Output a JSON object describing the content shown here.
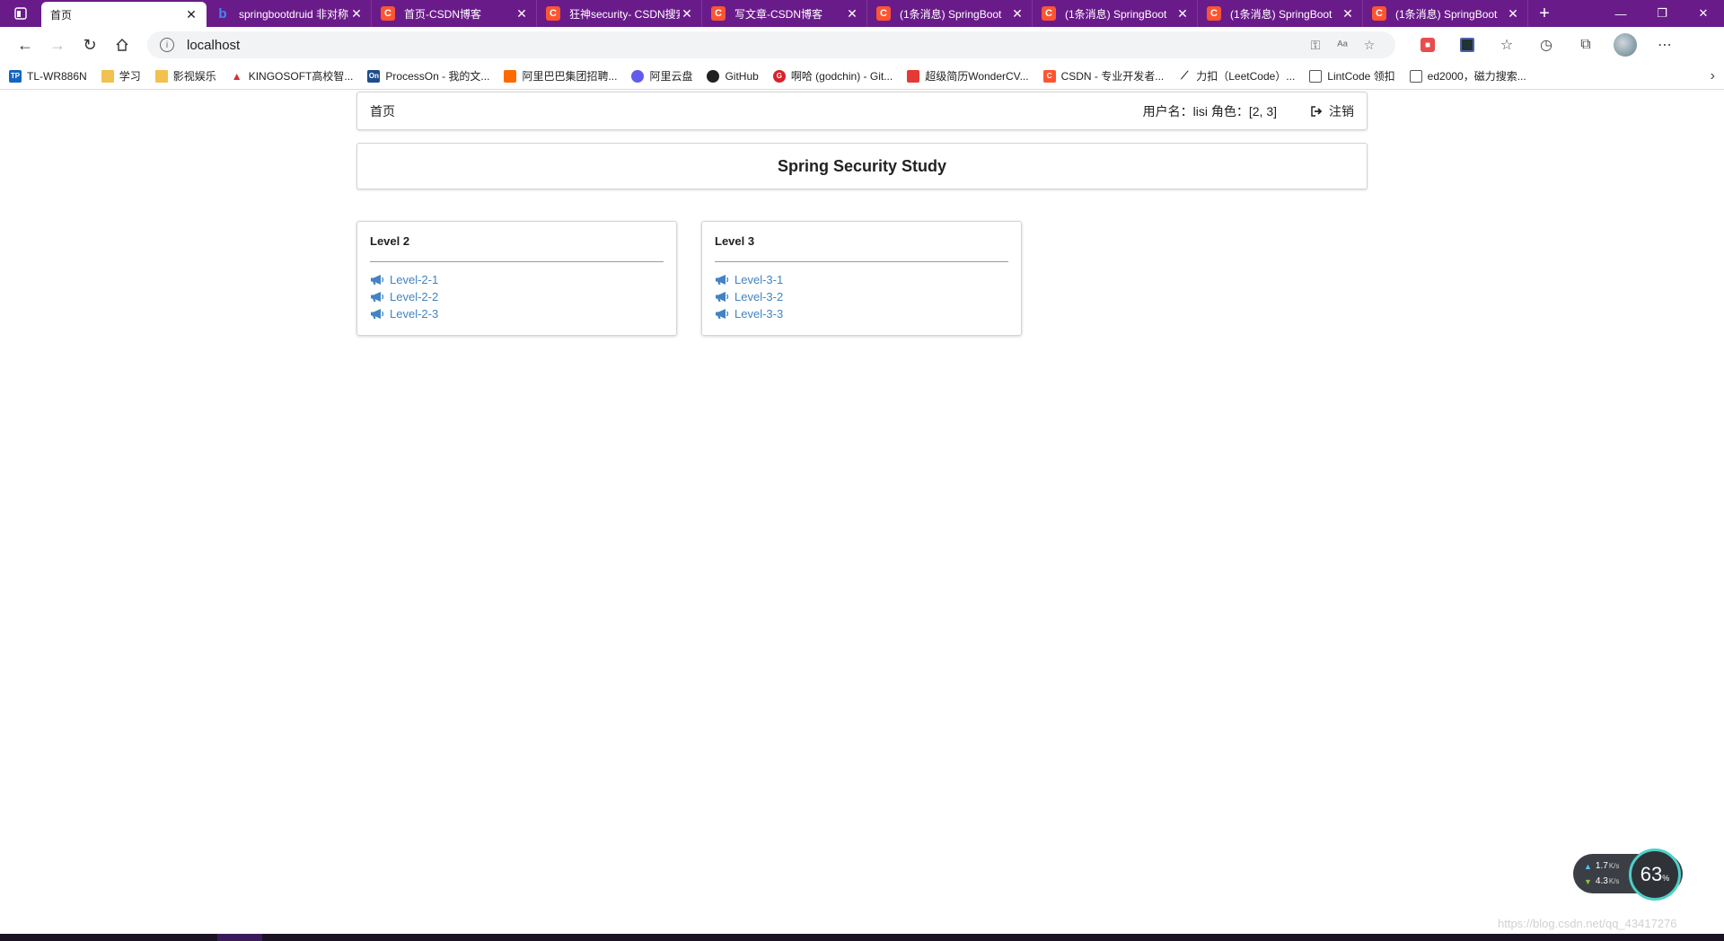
{
  "browser": {
    "tabs": [
      {
        "title": "首页",
        "icon": "page-icon",
        "active": true
      },
      {
        "title": "springbootdruid 非对称",
        "icon": "bing-icon"
      },
      {
        "title": "首页-CSDN博客",
        "icon": "csdn-icon"
      },
      {
        "title": "狂神security- CSDN搜索",
        "icon": "csdn-icon"
      },
      {
        "title": "写文章-CSDN博客",
        "icon": "csdn-icon"
      },
      {
        "title": "(1条消息) SpringBoot",
        "icon": "csdn-icon"
      },
      {
        "title": "(1条消息) SpringBoot",
        "icon": "csdn-icon"
      },
      {
        "title": "(1条消息) SpringBoot",
        "icon": "csdn-icon"
      },
      {
        "title": "(1条消息) SpringBoot",
        "icon": "csdn-icon"
      }
    ],
    "address": "localhost",
    "bookmarks": [
      {
        "label": "TL-WR886N",
        "icon": "tp"
      },
      {
        "label": "学习",
        "icon": "folder"
      },
      {
        "label": "影视娱乐",
        "icon": "folder"
      },
      {
        "label": "KINGOSOFT高校智...",
        "icon": "king"
      },
      {
        "label": "ProcessOn - 我的文...",
        "icon": "on"
      },
      {
        "label": "阿里巴巴集团招聘...",
        "icon": "ali"
      },
      {
        "label": "阿里云盘",
        "icon": "aliyun"
      },
      {
        "label": "GitHub",
        "icon": "gh"
      },
      {
        "label": "啊哈 (godchin) - Git...",
        "icon": "g"
      },
      {
        "label": "超级简历WonderCV...",
        "icon": "cv"
      },
      {
        "label": "CSDN - 专业开发者...",
        "icon": "csdn"
      },
      {
        "label": "力扣（LeetCode）...",
        "icon": "leet"
      },
      {
        "label": "LintCode 领扣",
        "icon": "doc"
      },
      {
        "label": "ed2000，磁力搜索...",
        "icon": "doc"
      }
    ]
  },
  "page": {
    "menu": {
      "home": "首页",
      "user_info": "用户名：lisi 角色：[2, 3]",
      "logout": "注销"
    },
    "title": "Spring Security Study",
    "cards": [
      {
        "heading": "Level 2",
        "links": [
          "Level-2-1",
          "Level-2-2",
          "Level-2-3"
        ]
      },
      {
        "heading": "Level 3",
        "links": [
          "Level-3-1",
          "Level-3-2",
          "Level-3-3"
        ]
      }
    ],
    "link_color": "#4183c4"
  },
  "overlay": {
    "net_up": "1.7",
    "net_down": "4.3",
    "unit": "K/s",
    "gauge_value": "63",
    "gauge_unit": "%",
    "watermark": "https://blog.csdn.net/qq_43417276"
  }
}
